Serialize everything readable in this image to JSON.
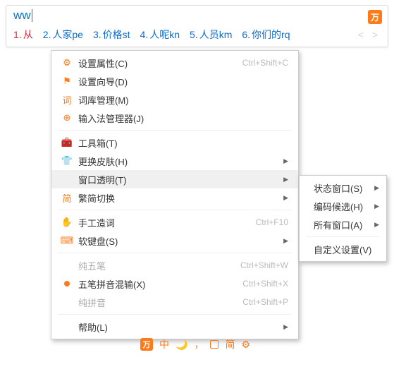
{
  "input": "ww",
  "candidates": [
    {
      "n": "1.",
      "t": "从"
    },
    {
      "n": "2.",
      "t": "人家pe"
    },
    {
      "n": "3.",
      "t": "价格st"
    },
    {
      "n": "4.",
      "t": "人呢kn"
    },
    {
      "n": "5.",
      "t": "人员km"
    },
    {
      "n": "6.",
      "t": "你们的rq"
    }
  ],
  "pager": "< >",
  "logo": "万",
  "menu": {
    "set_attr": "设置属性(C)",
    "set_attr_k": "Ctrl+Shift+C",
    "wizard": "设置向导(D)",
    "dict": "词库管理(M)",
    "ime_mgr": "输入法管理器(J)",
    "toolbox": "工具箱(T)",
    "skin": "更换皮肤(H)",
    "transparent": "窗口透明(T)",
    "trad": "繁简切换",
    "manual": "手工造词",
    "manual_k": "Ctrl+F10",
    "softkb": "软键盘(S)",
    "pure_wb": "纯五笔",
    "pure_wb_k": "Ctrl+Shift+W",
    "mix": "五笔拼音混输(X)",
    "mix_k": "Ctrl+Shift+X",
    "pure_py": "纯拼音",
    "pure_py_k": "Ctrl+Shift+P",
    "help": "帮助(L)"
  },
  "submenu": {
    "status": "状态窗口(S)",
    "coded": "编码候选(H)",
    "all": "所有窗口(A)",
    "custom": "自定义设置(V)"
  },
  "toolbar": {
    "cn": "中",
    "moon": "🌙",
    "comma": "，",
    "jian": "简",
    "gear": "⚙"
  }
}
